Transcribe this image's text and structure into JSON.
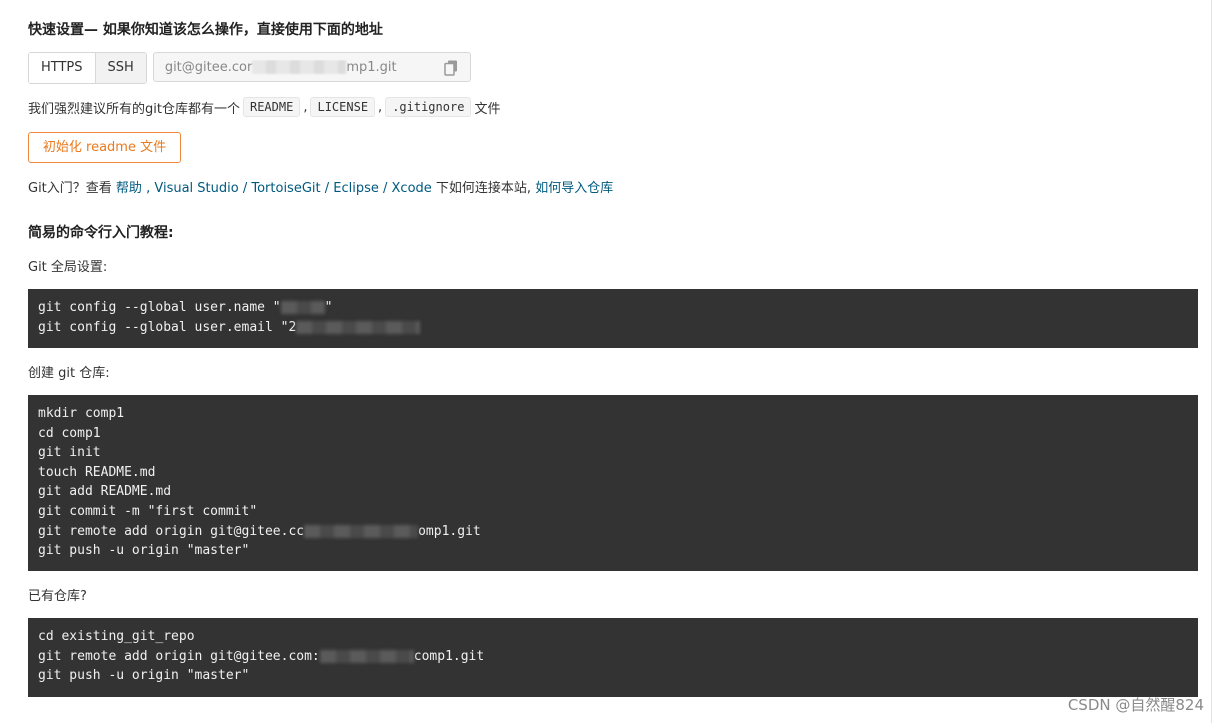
{
  "quick_setup": {
    "title": "快速设置— 如果你知道该怎么操作，直接使用下面的地址",
    "protocol_https": "HTTPS",
    "protocol_ssh": "SSH",
    "url_prefix": "git@gitee.cor",
    "url_suffix": "mp1.git",
    "copy_icon": "clipboard-icon"
  },
  "recommend": {
    "prefix": "我们强烈建议所有的git仓库都有一个",
    "readme": "README",
    "sep1": ",",
    "license": "LICENSE",
    "sep2": ",",
    "gitignore": ".gitignore",
    "suffix": "文件"
  },
  "init_button": "初始化 readme 文件",
  "help": {
    "prefix": "Git入门？查看 ",
    "help_link": "帮助",
    "sep0": " , ",
    "vs_link": "Visual Studio",
    "sep1": " / ",
    "tortoise_link": "TortoiseGit",
    "sep2": " / ",
    "eclipse_link": "Eclipse",
    "sep3": " / ",
    "xcode_link": "Xcode",
    "middle": " 下如何连接本站, ",
    "import_link": "如何导入仓库"
  },
  "tutorial_title": "简易的命令行入门教程:",
  "global_setup": {
    "label": "Git 全局设置:",
    "line1_prefix": "git config --global user.name \"",
    "line1_suffix": "\"",
    "line2_prefix": "git config --global user.email \"2"
  },
  "create_repo": {
    "label": "创建 git 仓库:",
    "lines": [
      "mkdir comp1",
      "cd comp1",
      "git init",
      "touch README.md",
      "git add README.md",
      "git commit -m \"first commit\""
    ],
    "remote_prefix": "git remote add origin git@gitee.cc",
    "remote_suffix": "omp1.git",
    "push": "git push -u origin \"master\""
  },
  "existing_repo": {
    "label": "已有仓库?",
    "line1": "cd existing_git_repo",
    "remote_prefix": "git remote add origin git@gitee.com:",
    "remote_suffix": "comp1.git",
    "push": "git push -u origin \"master\""
  },
  "watermark": "CSDN @自然醒824",
  "colors": {
    "code_bg": "#333333",
    "link": "#005980",
    "init_border": "#f0883e"
  }
}
